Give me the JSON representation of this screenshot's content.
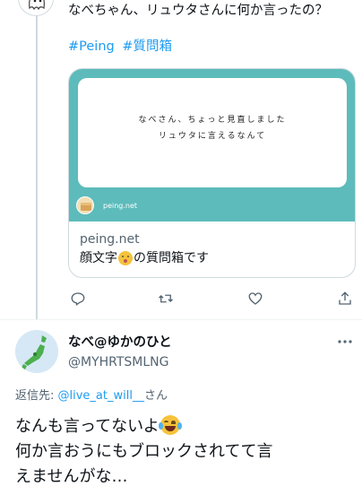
{
  "quoted_tweet": {
    "text": "なべちゃん、リュウタさんに何か言ったの？",
    "hashtags": [
      "#Peing",
      "#質問箱"
    ],
    "card": {
      "image_text_line1": "なべさん、ちょっと見直しました",
      "image_text_line2": "リュウタに言えるなんて",
      "brand_name": "peing.net",
      "domain": "peing.net",
      "title_before": "顔文字",
      "title_after": "の質問箱です"
    },
    "actions": [
      "reply-icon",
      "retweet-icon",
      "like-icon",
      "share-icon"
    ]
  },
  "reply_tweet": {
    "display_name": "なべ@ゆかのひと",
    "handle": "@MYHRTSMLNG",
    "reply_to_prefix": "返信先: ",
    "reply_to_mention": "@live_at_will__",
    "reply_to_suffix": "さん",
    "text_line1": "なんも言ってないよ",
    "text_line2": "何か言おうにもブロックされてて言",
    "text_line3": "えませんがな…"
  },
  "colors": {
    "accent": "#1d9bf0",
    "muted": "#536471",
    "card_bg": "#5dbbbb",
    "border": "#cfd9de"
  }
}
